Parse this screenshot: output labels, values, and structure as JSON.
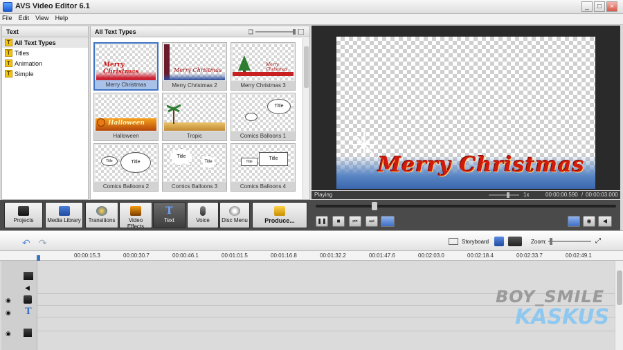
{
  "window": {
    "title": "AVS Video Editor 6.1",
    "min": "_",
    "max": "□",
    "close": "×"
  },
  "menu": [
    "File",
    "Edit",
    "View",
    "Help"
  ],
  "left_panel": {
    "header": "Text",
    "items": [
      {
        "label": "All Text Types"
      },
      {
        "label": "Titles"
      },
      {
        "label": "Animation"
      },
      {
        "label": "Simple"
      }
    ]
  },
  "grid_panel": {
    "header": "All Text Types",
    "cards": [
      {
        "caption": "Merry Christmas",
        "overlay": "Merry Christmas"
      },
      {
        "caption": "Merry Christmas 2",
        "overlay": "Merry Christmas"
      },
      {
        "caption": "Merry Christmas 3",
        "overlay": "Merry Christmas"
      },
      {
        "caption": "Halloween",
        "overlay": "Halloween"
      },
      {
        "caption": "Tropic",
        "overlay": ""
      },
      {
        "caption": "Comics Balloons 1",
        "overlay": "Title"
      },
      {
        "caption": "Comics Balloons 2",
        "overlay": "Title"
      },
      {
        "caption": "Comics Balloons 3",
        "overlay": "Title"
      },
      {
        "caption": "Comics Balloons 4",
        "overlay": "Title"
      }
    ],
    "balloon_small": "Title"
  },
  "preview": {
    "overlay_text": "Merry Christmas",
    "status": "Playing",
    "speed": "1x",
    "time": "00:00:00.590",
    "separator": "/",
    "duration": "00:00:03.000"
  },
  "toolbar": {
    "buttons": [
      {
        "label": "Projects"
      },
      {
        "label": "Media Library"
      },
      {
        "label": "Transitions"
      },
      {
        "label": "Video Effects"
      },
      {
        "label": "Text"
      },
      {
        "label": "Voice"
      },
      {
        "label": "Disc Menu"
      },
      {
        "label": "Produce..."
      }
    ]
  },
  "timeline": {
    "storyboard_label": "Storyboard",
    "zoom_label": "Zoom:",
    "ruler": [
      "00:00:15.3",
      "00:00:30.7",
      "00:00:46.1",
      "00:01:01.5",
      "00:01:16.8",
      "00:01:32.2",
      "00:01:47.6",
      "00:02:03.0",
      "00:02:18.4",
      "00:02:33.7",
      "00:02:49.1"
    ]
  },
  "watermark": {
    "line1": "BOY_SMILE",
    "line2": "KASKUS"
  },
  "colors": {
    "accent": "#3d73c5",
    "dark": "#4a4a4a",
    "text_red": "#d11a0d"
  }
}
